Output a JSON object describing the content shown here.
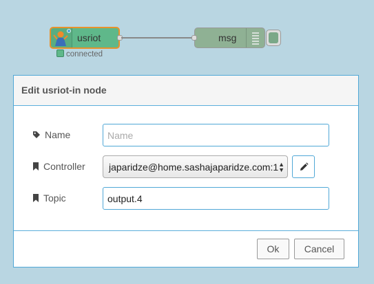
{
  "flow": {
    "source_node": {
      "label": "usriot",
      "status": "connected"
    },
    "target_node": {
      "label": "msg"
    }
  },
  "dialog": {
    "title": "Edit usriot-in node",
    "fields": {
      "name": {
        "label": "Name",
        "placeholder": "Name",
        "value": ""
      },
      "controller": {
        "label": "Controller",
        "value": "japaridze@home.sashajaparidze.com:1"
      },
      "topic": {
        "label": "Topic",
        "value": "output.4"
      }
    },
    "ok_label": "Ok",
    "cancel_label": "Cancel"
  },
  "colors": {
    "canvas": "#b9d6e2",
    "node_usriot": "#5fb88a",
    "node_selected_border": "#e8912a",
    "node_msg": "#8fb194",
    "accent_border": "#4fa7d6"
  },
  "icons": [
    "person-icon",
    "list-icon",
    "tag-icon",
    "bookmark-icon",
    "pencil-icon"
  ]
}
